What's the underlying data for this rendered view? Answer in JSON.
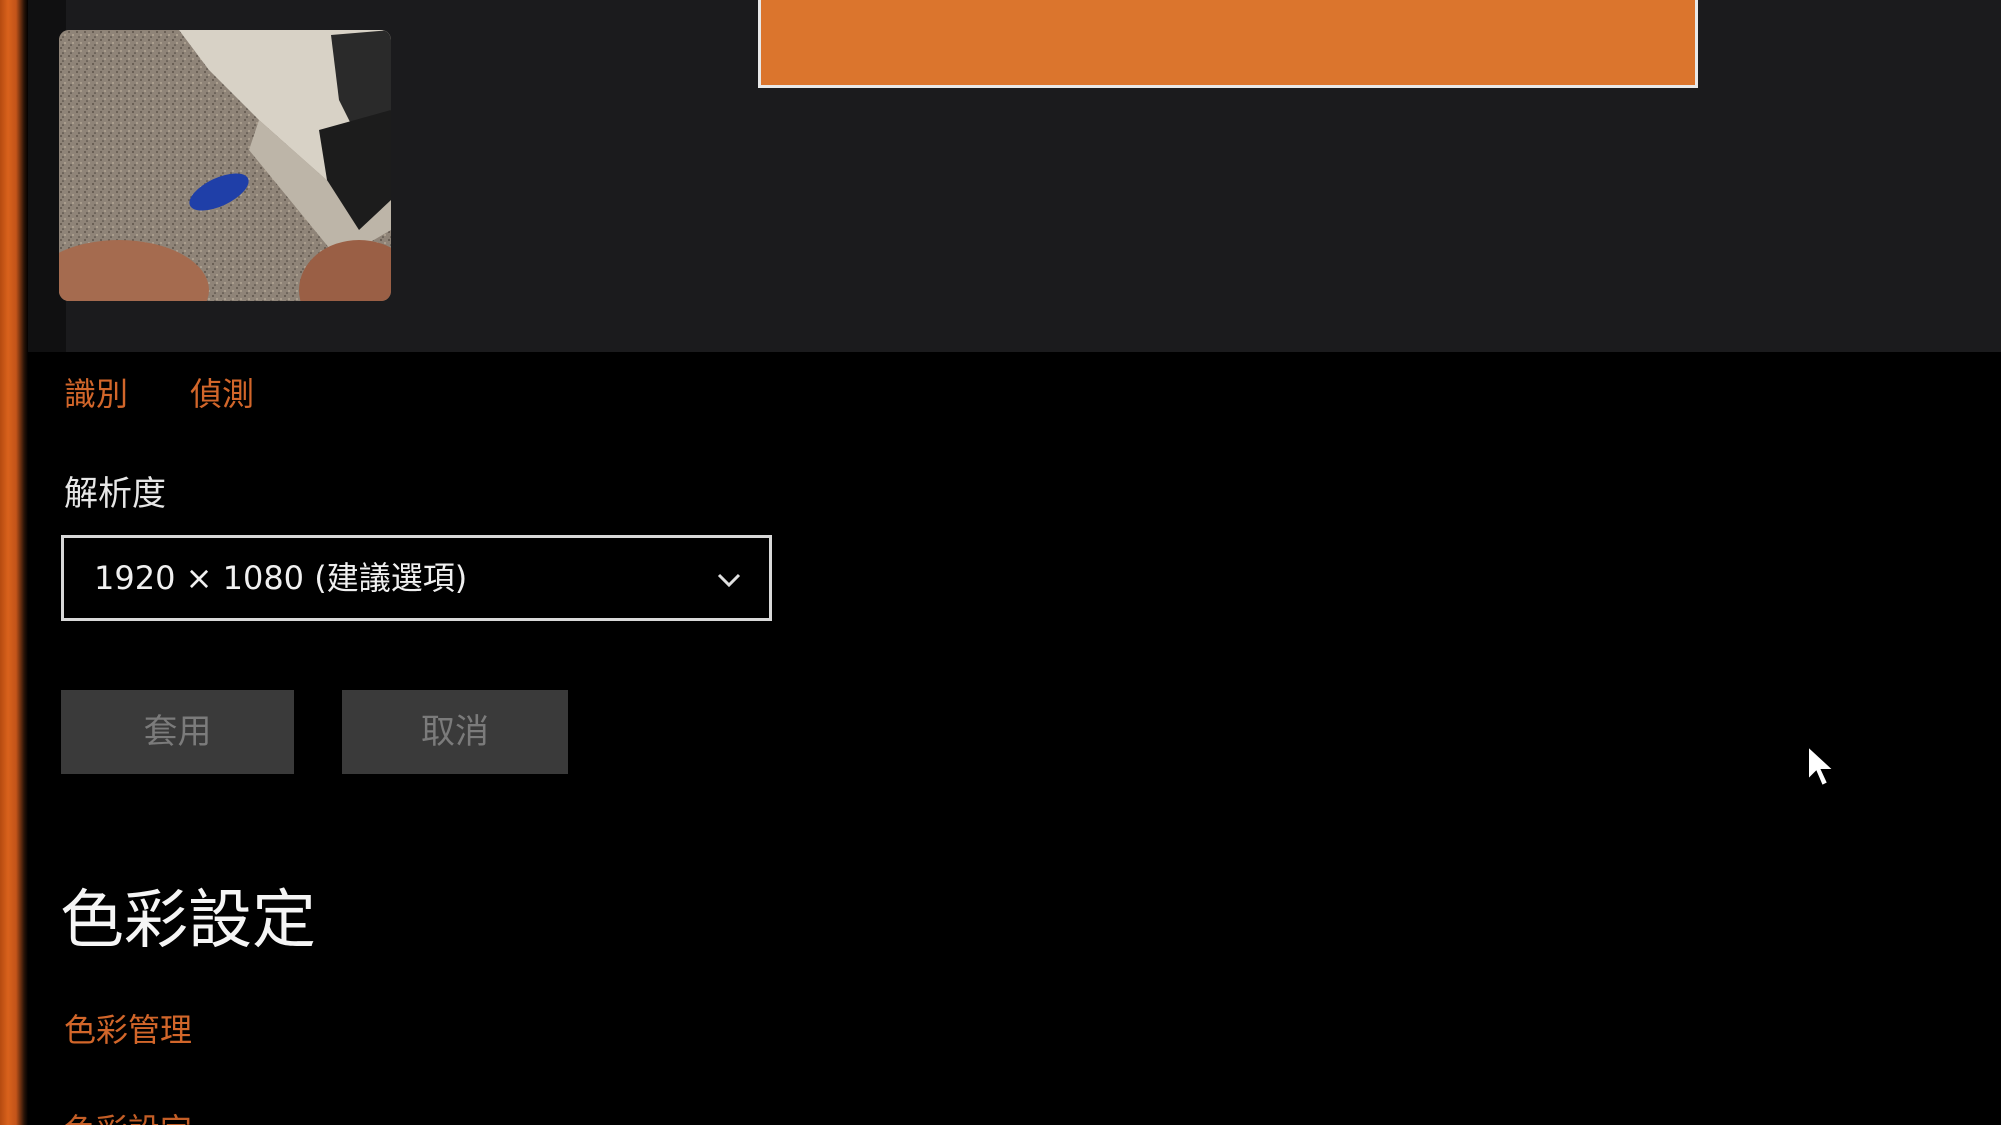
{
  "display_preview": {
    "monitor_color": "#db752d",
    "camera_thumbnail": "camera-preview-image"
  },
  "links": {
    "identify": "識別",
    "detect": "偵測"
  },
  "resolution": {
    "label": "解析度",
    "selected_value": "1920 × 1080 (建議選項)",
    "dropdown_icon": "chevron-down-icon"
  },
  "buttons": {
    "apply": "套用",
    "cancel": "取消"
  },
  "color_settings": {
    "title": "色彩設定",
    "color_management_link": "色彩管理",
    "next_link_partial": "色彩設定"
  },
  "colors": {
    "accent": "#d2662a",
    "background": "#000000",
    "preview_background": "#1b1b1d",
    "button_background": "#3a3a3a"
  },
  "icons": {
    "cursor": "mouse-pointer-icon"
  }
}
